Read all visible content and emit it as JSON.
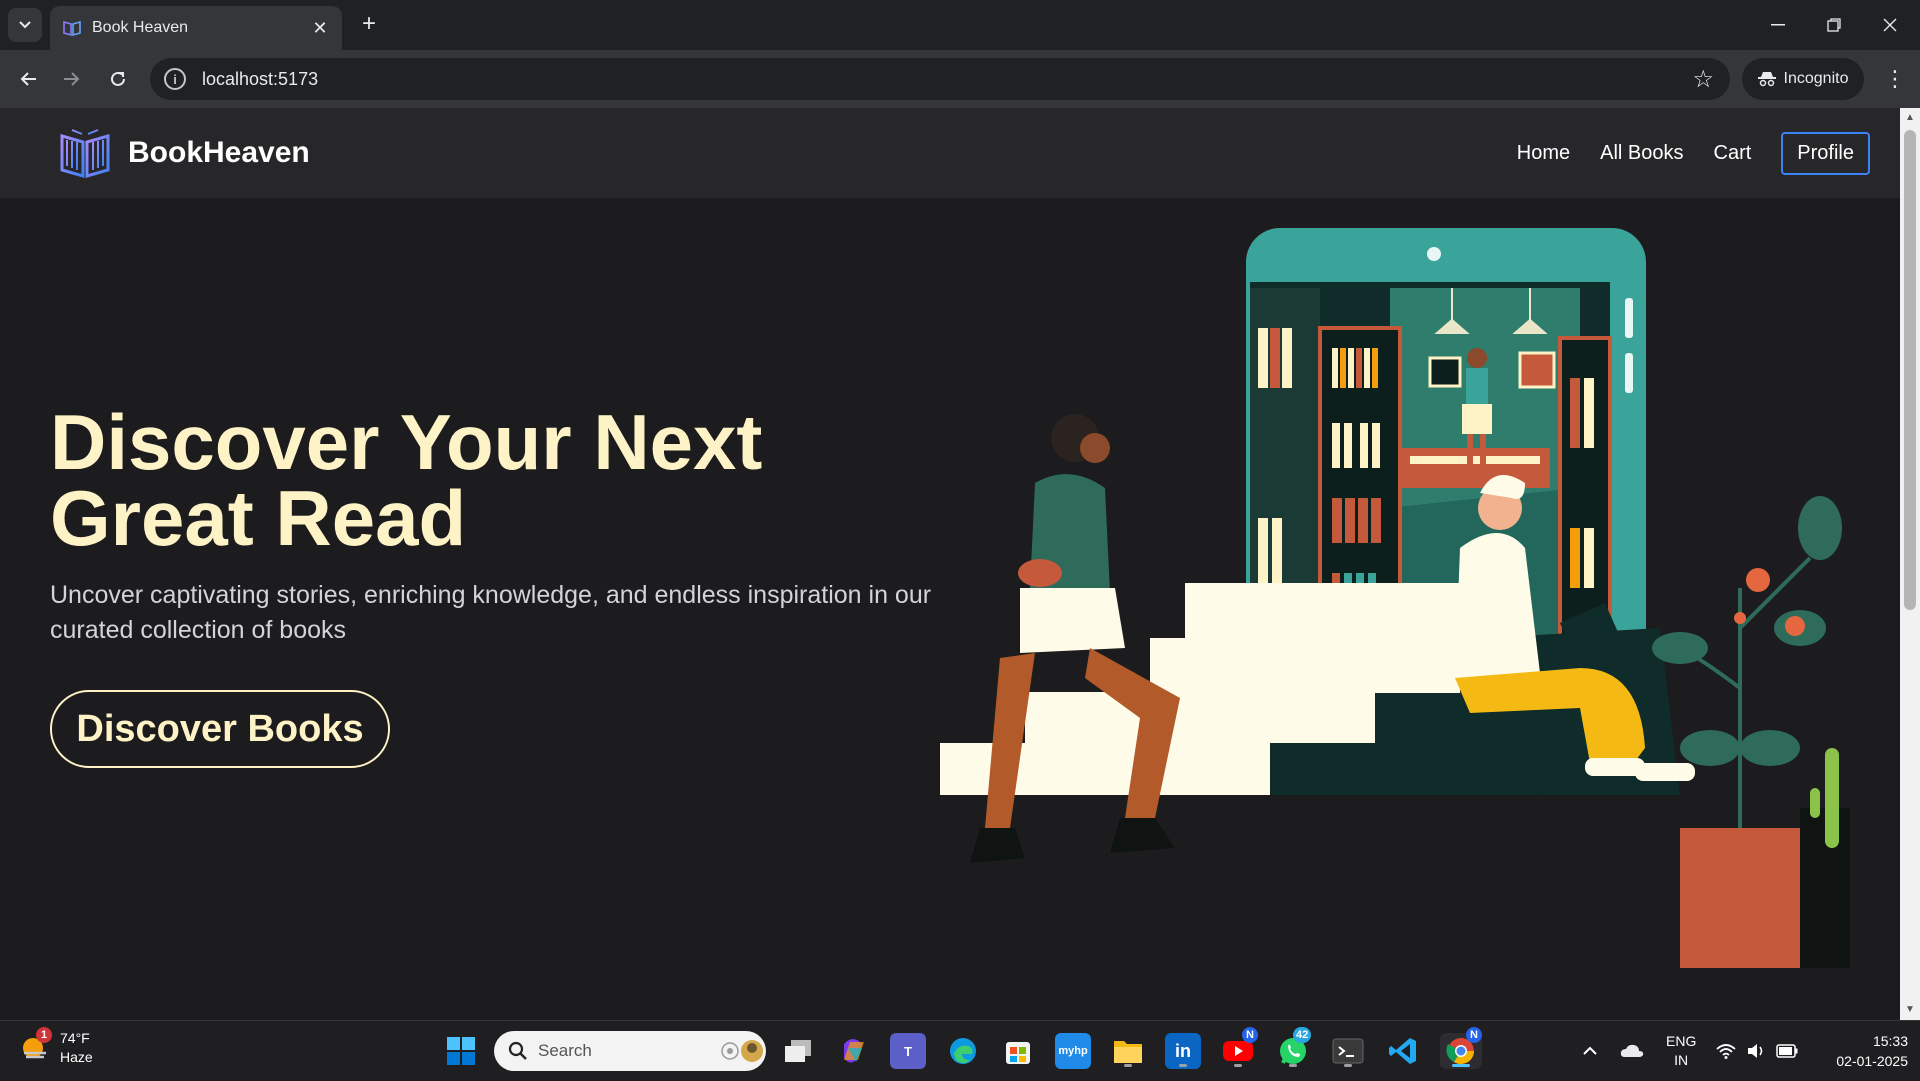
{
  "browser": {
    "tab_title": "Book Heaven",
    "url": "localhost:5173",
    "incognito_label": "Incognito"
  },
  "site": {
    "brand": "BookHeaven",
    "nav": [
      "Home",
      "All Books",
      "Cart"
    ],
    "profile_label": "Profile"
  },
  "hero": {
    "title": "Discover Your Next Great Read",
    "subtitle": "Uncover captivating stories, enriching knowledge, and endless inspiration in our curated collection of books",
    "cta": "Discover Books"
  },
  "taskbar": {
    "weather_temp": "74°F",
    "weather_desc": "Haze",
    "weather_badge": "1",
    "search_placeholder": "Search",
    "youtube_badge": "N",
    "whatsapp_badge": "42",
    "chrome_badge": "N",
    "lang_top": "ENG",
    "lang_bottom": "IN",
    "time": "15:33",
    "date": "02-01-2025",
    "apps": [
      "task-view",
      "copilot",
      "teams",
      "edge",
      "store",
      "myhp",
      "file-explorer",
      "linkedin",
      "youtube",
      "whatsapp",
      "terminal",
      "vscode",
      "chrome"
    ]
  },
  "colors": {
    "accent_cream": "#fef3c7",
    "nav_bg": "#27272a",
    "page_bg": "#1c1b1e",
    "profile_border": "#3b82f6"
  }
}
